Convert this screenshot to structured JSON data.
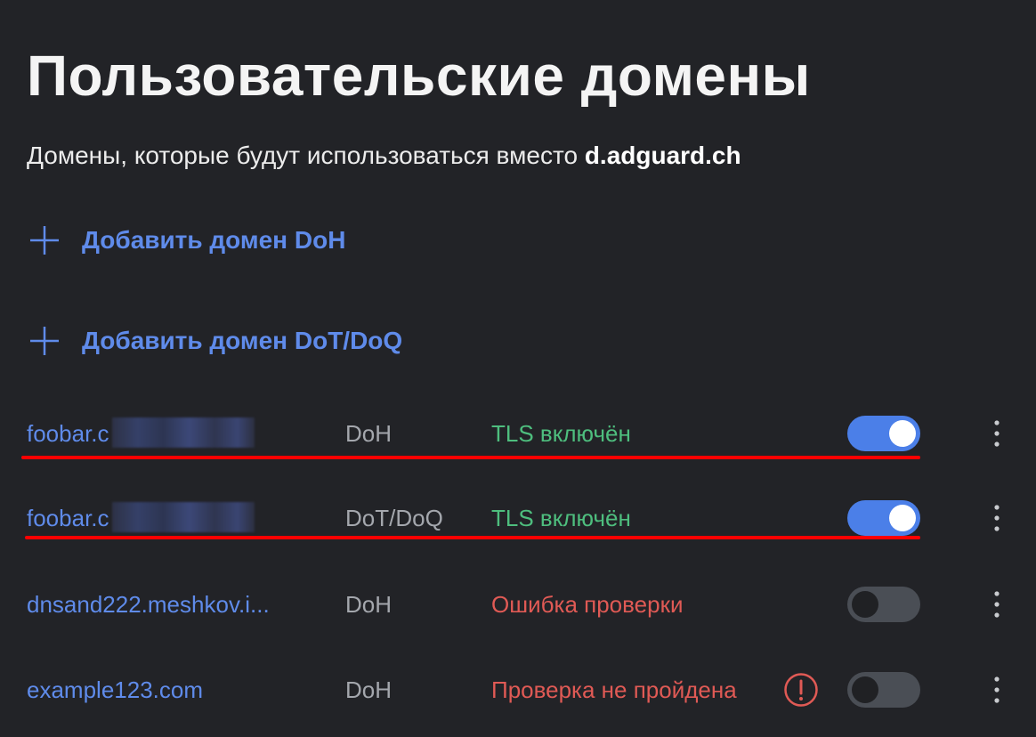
{
  "header": {
    "title": "Пользовательские домены",
    "subtitle_prefix": "Домены, которые будут использоваться вместо ",
    "subtitle_domain": "d.adguard.ch"
  },
  "actions": {
    "add_doh_label": "Добавить домен DoH",
    "add_dot_label": "Добавить домен DoT/DoQ"
  },
  "domains": [
    {
      "name": "foobar.c",
      "protocol": "DoH",
      "status": "TLS включён",
      "status_type": "ok",
      "enabled": true,
      "name_blurred": true
    },
    {
      "name": "foobar.c",
      "protocol": "DoT/DoQ",
      "status": "TLS включён",
      "status_type": "ok",
      "enabled": true,
      "name_blurred": true
    },
    {
      "name": "dnsand222.meshkov.i...",
      "protocol": "DoH",
      "status": "Ошибка проверки",
      "status_type": "error",
      "enabled": false
    },
    {
      "name": "example123.com",
      "protocol": "DoH",
      "status": "Проверка не пройдена",
      "status_type": "error",
      "enabled": false,
      "has_error_icon": true
    }
  ],
  "colors": {
    "background": "#222327",
    "link": "#5f8bea",
    "status_ok": "#4ebe7e",
    "status_error": "#e05a55",
    "toggle_on": "#4b7fe8",
    "toggle_off": "#4a4e55",
    "annotation": "#ff0000"
  },
  "icons": {
    "add": "plus-icon",
    "row_menu": "more-vertical-icon",
    "warning": "exclamation-circle-icon"
  }
}
